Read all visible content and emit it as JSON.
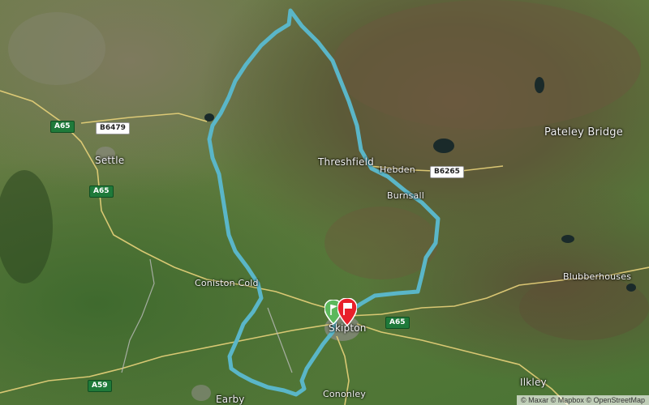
{
  "map": {
    "route_color": "#5ab6c8",
    "start_color": "#5cb85c",
    "finish_color": "#e8202a",
    "places": [
      {
        "key": "settle",
        "label": "Settle"
      },
      {
        "key": "threshfield",
        "label": "Threshfield"
      },
      {
        "key": "hebden",
        "label": "Hebden"
      },
      {
        "key": "burnsall",
        "label": "Burnsall"
      },
      {
        "key": "pateley",
        "label": "Pateley Bridge"
      },
      {
        "key": "coniston_cold",
        "label": "Coniston Cold"
      },
      {
        "key": "blubberhouses",
        "label": "Blubberhouses"
      },
      {
        "key": "skipton",
        "label": "Skipton"
      },
      {
        "key": "cononley",
        "label": "Cononley"
      },
      {
        "key": "ilkley",
        "label": "Ilkley"
      },
      {
        "key": "earby",
        "label": "Earby"
      }
    ],
    "roads": [
      {
        "key": "a65_nw",
        "label": "A65",
        "class": "primary"
      },
      {
        "key": "b6479",
        "label": "B6479",
        "class": "secondary"
      },
      {
        "key": "a65_w",
        "label": "A65",
        "class": "primary"
      },
      {
        "key": "b6265",
        "label": "B6265",
        "class": "secondary"
      },
      {
        "key": "a65_e",
        "label": "A65",
        "class": "primary"
      },
      {
        "key": "a59",
        "label": "A59",
        "class": "primary"
      }
    ],
    "markers": {
      "start_icon": "start-flag-icon",
      "finish_icon": "finish-flag-icon"
    },
    "attribution": "© Maxar © Mapbox © OpenStreetMap"
  }
}
